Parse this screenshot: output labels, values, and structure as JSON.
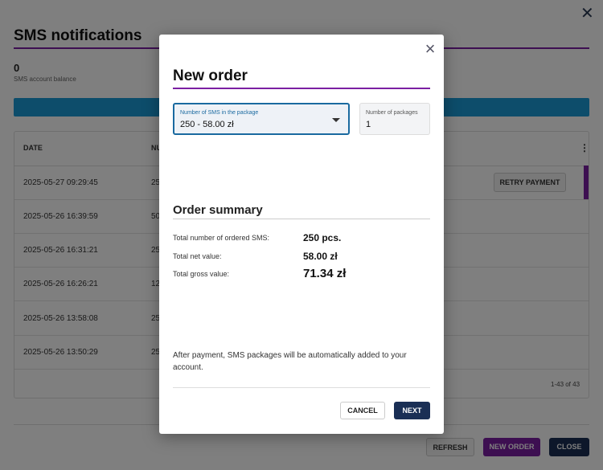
{
  "background": {
    "title": "SMS notifications",
    "balance_value": "0",
    "balance_label": "SMS account balance",
    "table": {
      "headers": {
        "date": "DATE",
        "number": "NU"
      },
      "rows": [
        {
          "date": "2025-05-27 09:29:45",
          "number": "25"
        },
        {
          "date": "2025-05-26 16:39:59",
          "number": "50"
        },
        {
          "date": "2025-05-26 16:31:21",
          "number": "25"
        },
        {
          "date": "2025-05-26 16:26:21",
          "number": "12"
        },
        {
          "date": "2025-05-26 13:58:08",
          "number": "25"
        },
        {
          "date": "2025-05-26 13:50:29",
          "number": "25"
        }
      ],
      "retry_label": "RETRY PAYMENT",
      "pager": "1-43 of 43"
    },
    "buttons": {
      "refresh": "REFRESH",
      "new_order": "NEW ORDER",
      "close": "CLOSE"
    }
  },
  "modal": {
    "title": "New order",
    "package_select": {
      "label": "Number of SMS in the package",
      "value": "250 - 58.00 zł"
    },
    "packages_count": {
      "label": "Number of packages",
      "value": "1"
    },
    "summary": {
      "title": "Order summary",
      "total_sms_label": "Total number of ordered SMS:",
      "total_sms_value": "250 pcs.",
      "net_label": "Total net value:",
      "net_value": "58.00 zł",
      "gross_label": "Total gross value:",
      "gross_value": "71.34 zł"
    },
    "info": "After payment, SMS packages will be automatically added to your account.",
    "buttons": {
      "cancel": "CANCEL",
      "next": "NEXT"
    }
  },
  "colors": {
    "accent": "#7b1fa2",
    "primary": "#1a2f55",
    "info_bar": "#1a9bd6"
  }
}
